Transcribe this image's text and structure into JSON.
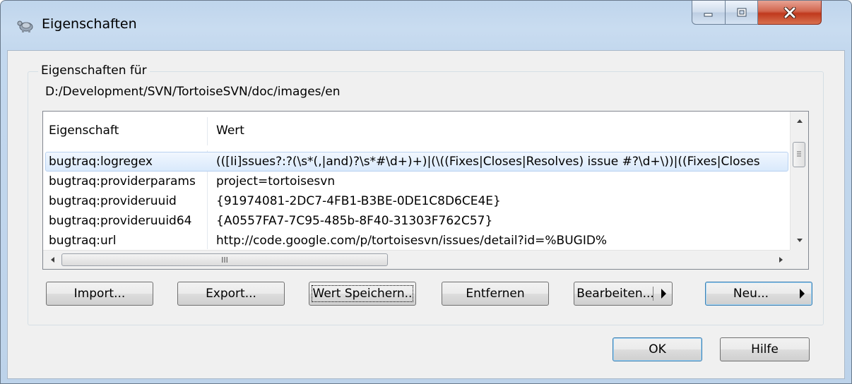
{
  "window": {
    "title": "Eigenschaften",
    "title_icon": "tortoise-icon"
  },
  "caption_buttons": {
    "minimize_icon": "minimize-icon",
    "maximize_icon": "maximize-icon",
    "close_icon": "close-icon",
    "close_color": "#c7432a"
  },
  "group": {
    "legend": "Eigenschaften für",
    "path": "D:/Development/SVN/TortoiseSVN/doc/images/en"
  },
  "list": {
    "columns": [
      "Eigenschaft",
      "Wert"
    ],
    "rows": [
      {
        "name": "bugtraq:logregex",
        "value": "(([Ii]ssues?:?(\\s*(,|and)?\\s*#\\d+)+)|(\\((Fixes|Closes|Resolves) issue #?\\d+\\))|((Fixes|Closes",
        "selected": true
      },
      {
        "name": "bugtraq:providerparams",
        "value": "project=tortoisesvn",
        "selected": false
      },
      {
        "name": "bugtraq:provideruuid",
        "value": "{91974081-2DC7-4FB1-B3BE-0DE1C8D6CE4E}",
        "selected": false
      },
      {
        "name": "bugtraq:provideruuid64",
        "value": "{A0557FA7-7C95-485b-8F40-31303F762C57}",
        "selected": false
      },
      {
        "name": "bugtraq:url",
        "value": "http://code.google.com/p/tortoisesvn/issues/detail?id=%BUGID%",
        "selected": false
      }
    ],
    "hscroll_grip": "III",
    "selection_color": "#d9e9fc"
  },
  "buttons": {
    "import": "Import...",
    "export": "Export...",
    "save_value": "Wert Speichern..",
    "remove": "Entfernen",
    "edit": "Bearbeiten...",
    "new": "Neu...",
    "ok": "OK",
    "help": "Hilfe"
  }
}
